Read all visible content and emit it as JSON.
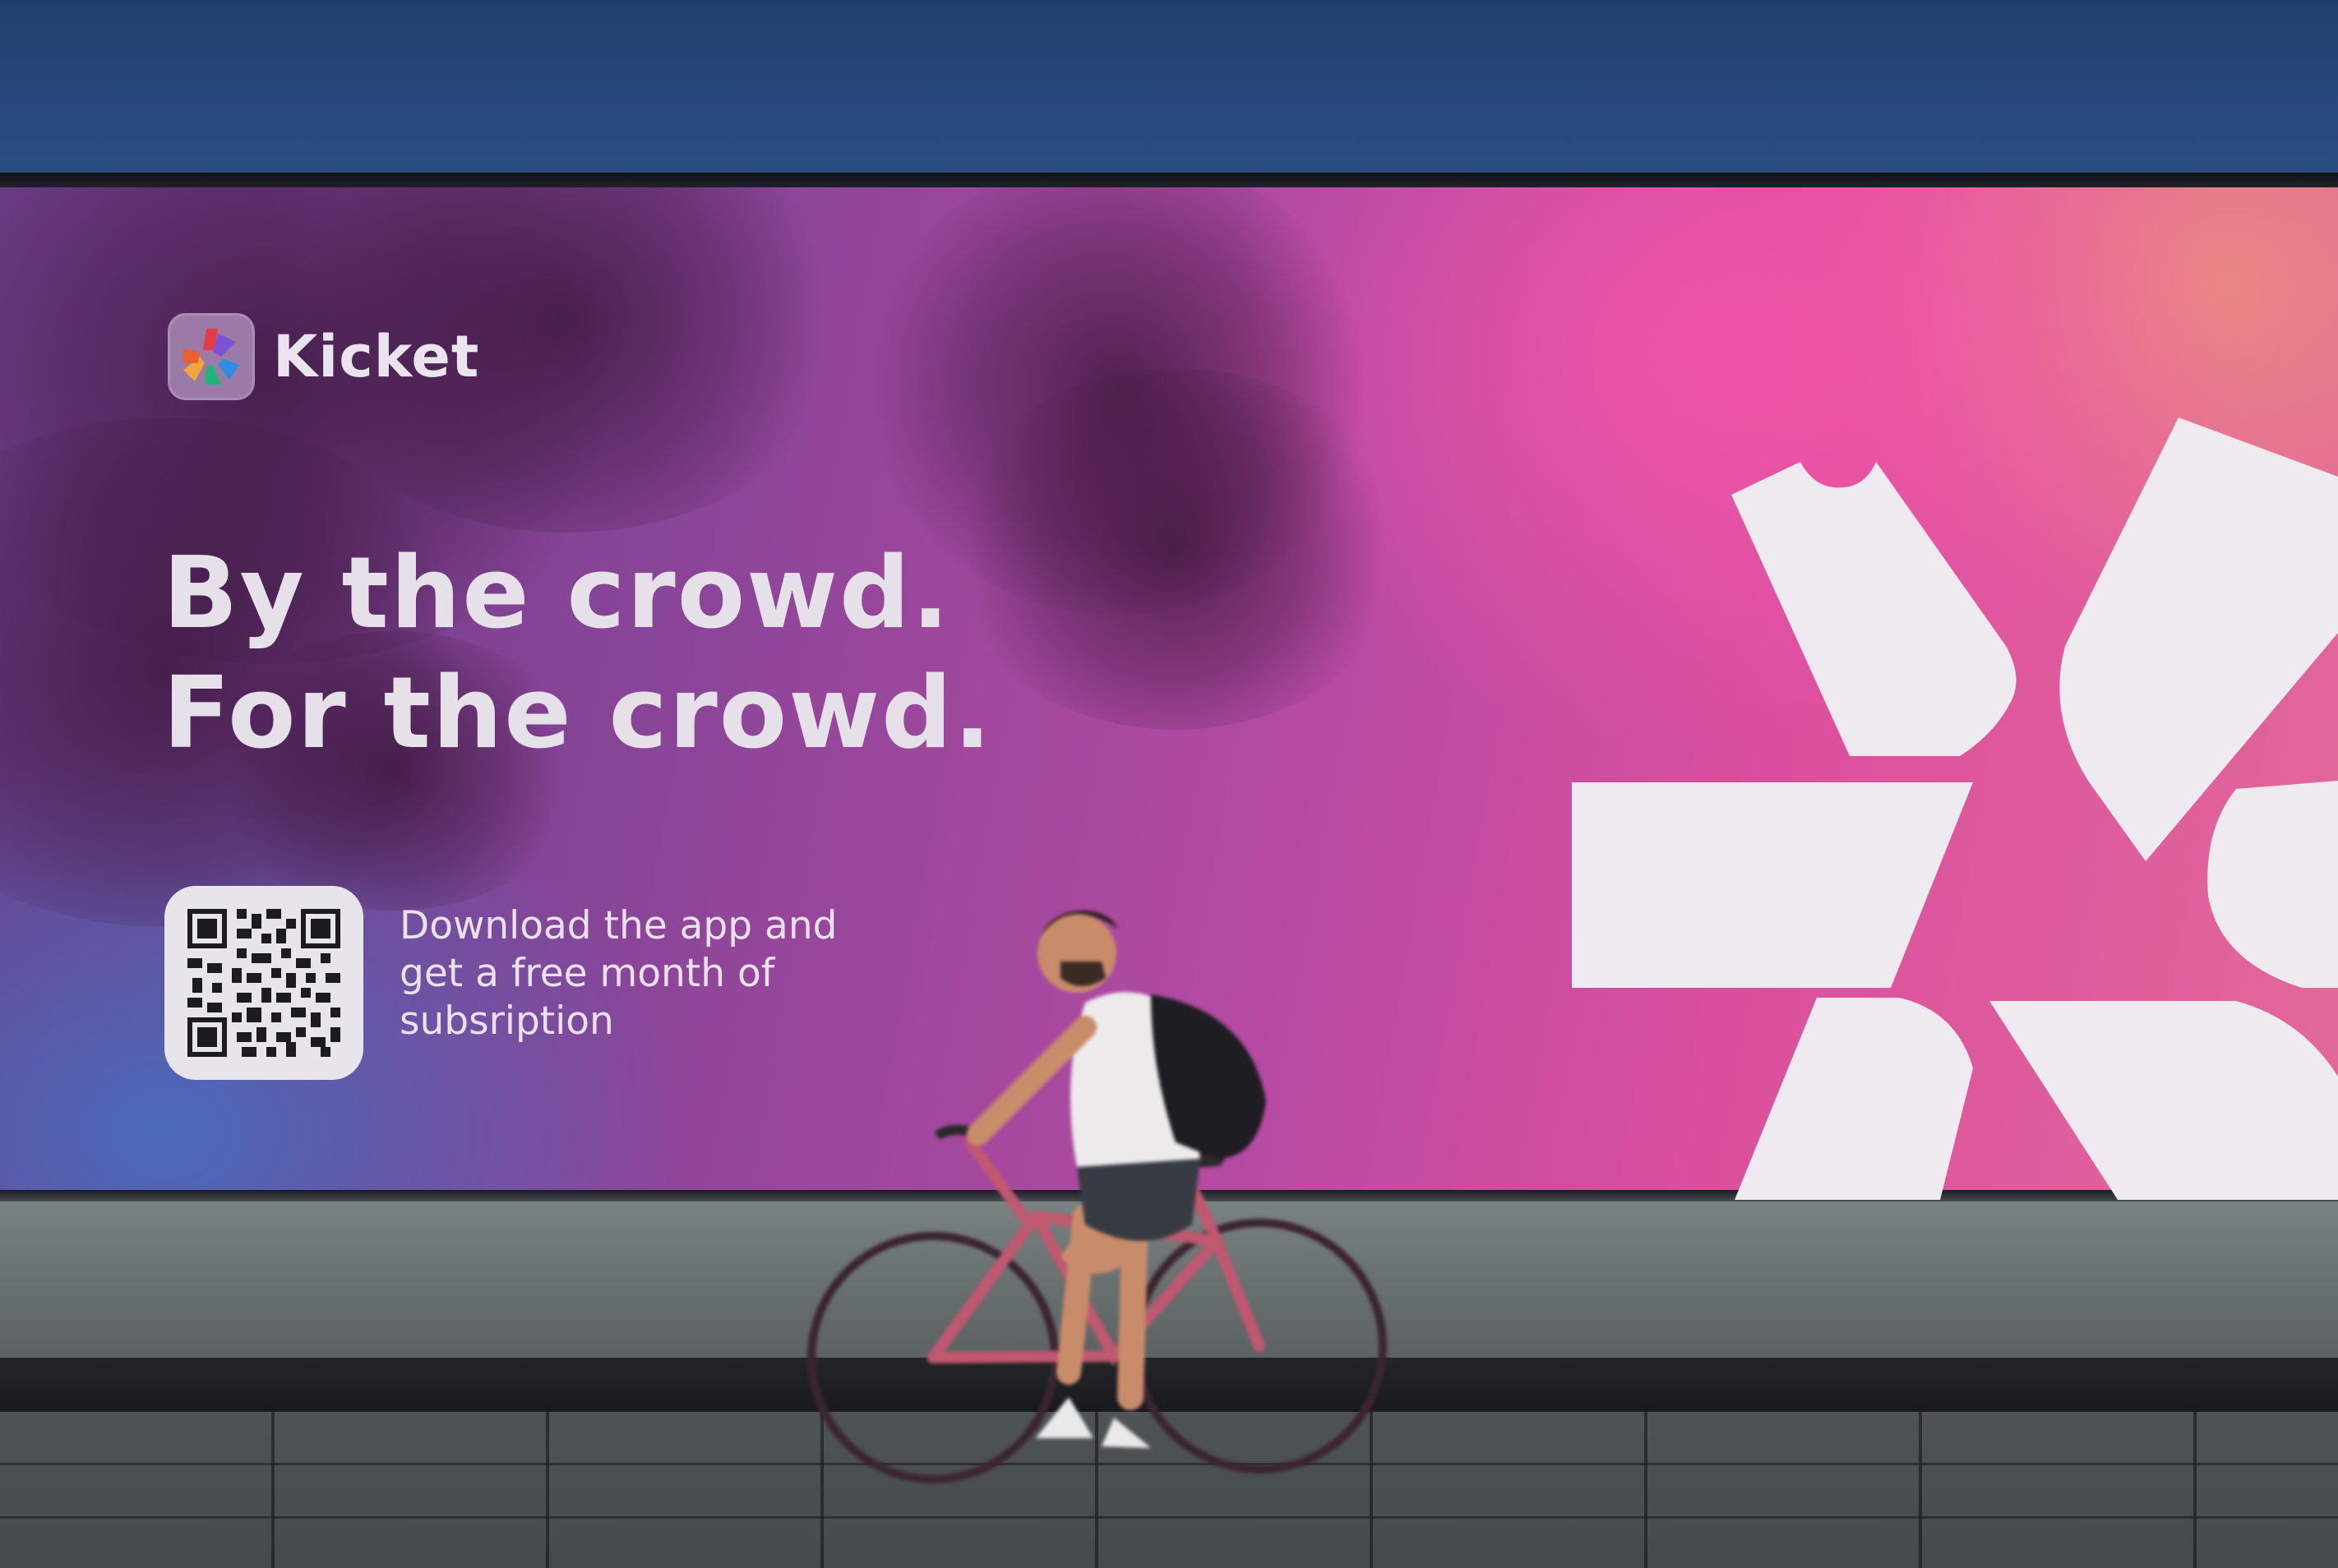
{
  "brand": {
    "name": "Kicket"
  },
  "headline": {
    "line1": "By the crowd.",
    "line2": "For the crowd."
  },
  "promo": {
    "line1": "Download the app and",
    "line2": "get a free month of",
    "line3": "subsription"
  },
  "colors": {
    "facade_blue": "#27487a",
    "billboard_purple": "#7a3f8f",
    "billboard_pink": "#dc4f9e",
    "text_light": "#e6e1e8",
    "ticket_white": "#efeaef"
  },
  "icons": {
    "logo": "multicolor-ticket-star-icon",
    "qr": "qr-code-icon",
    "graphic": "ticket-star-graphic"
  }
}
